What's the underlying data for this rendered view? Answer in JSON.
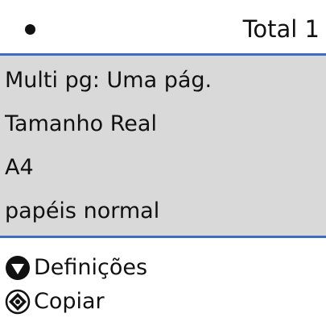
{
  "header": {
    "indicator_icon": "bullet-dot-icon",
    "total_label": "Total 1"
  },
  "settings": [
    {
      "label": "Multi pg: Uma pág."
    },
    {
      "label": "Tamanho Real"
    },
    {
      "label": "A4"
    },
    {
      "label": "papéis normal"
    }
  ],
  "actions": {
    "definitions": {
      "icon": "down-triangle-button-icon",
      "label": "Definições"
    },
    "copy": {
      "icon": "diamond-start-button-icon",
      "label": "Copiar"
    }
  },
  "colors": {
    "divider": "#3e6cc0",
    "panel_background": "#d9d9d9",
    "text": "#111111"
  }
}
